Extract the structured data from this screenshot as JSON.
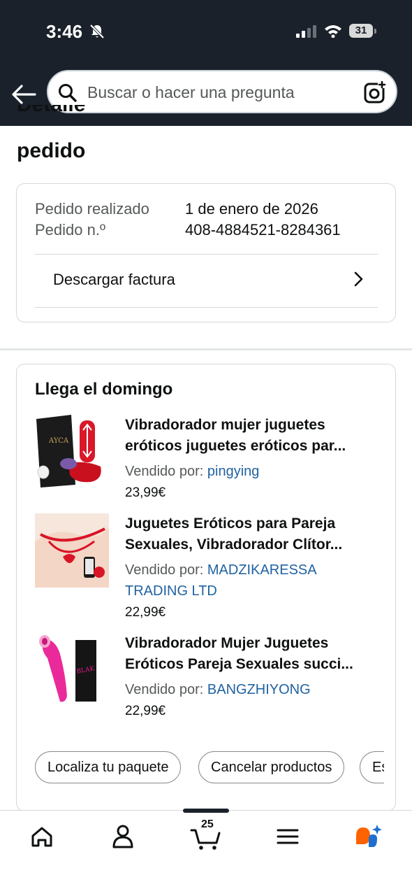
{
  "status": {
    "time": "3:46",
    "battery": "31"
  },
  "search": {
    "placeholder": "Buscar o hacer una pregunta"
  },
  "page": {
    "title_line1": "Detalles del",
    "title_line2": "pedido"
  },
  "order": {
    "placed_label": "Pedido realizado",
    "placed_value": "1 de enero de 2026",
    "number_label": "Pedido n.º",
    "number_value": "408-4884521-8284361",
    "invoice_label": "Descargar factura"
  },
  "shipment": {
    "arrival": "Llega el domingo",
    "sold_by_label": "Vendido por:",
    "items": [
      {
        "title1": "Vibradorador mujer juguetes",
        "title2": "eróticos juguetes eróticos par...",
        "seller": "pingying",
        "price": "23,99€"
      },
      {
        "title1": "Juguetes Eróticos para Pareja",
        "title2": "Sexuales, Vibradorador Clítor...",
        "seller1": "MADZIKARESSA",
        "seller2": "TRADING LTD",
        "price": "22,99€"
      },
      {
        "title1": "Vibradorador Mujer Juguetes",
        "title2": "Eróticos Pareja Sexuales succi...",
        "seller": "BANGZHIYONG",
        "price": "22,99€"
      }
    ],
    "actions": [
      "Localiza tu paquete",
      "Cancelar productos",
      "Es"
    ]
  },
  "tabbar": {
    "cart_count": "25",
    "icons": [
      "home-icon",
      "account-icon",
      "cart-icon",
      "menu-icon",
      "rufus-icon"
    ]
  },
  "colors": {
    "bar": "#1a212b",
    "link": "#2162a1",
    "accent": "#ff6200"
  }
}
